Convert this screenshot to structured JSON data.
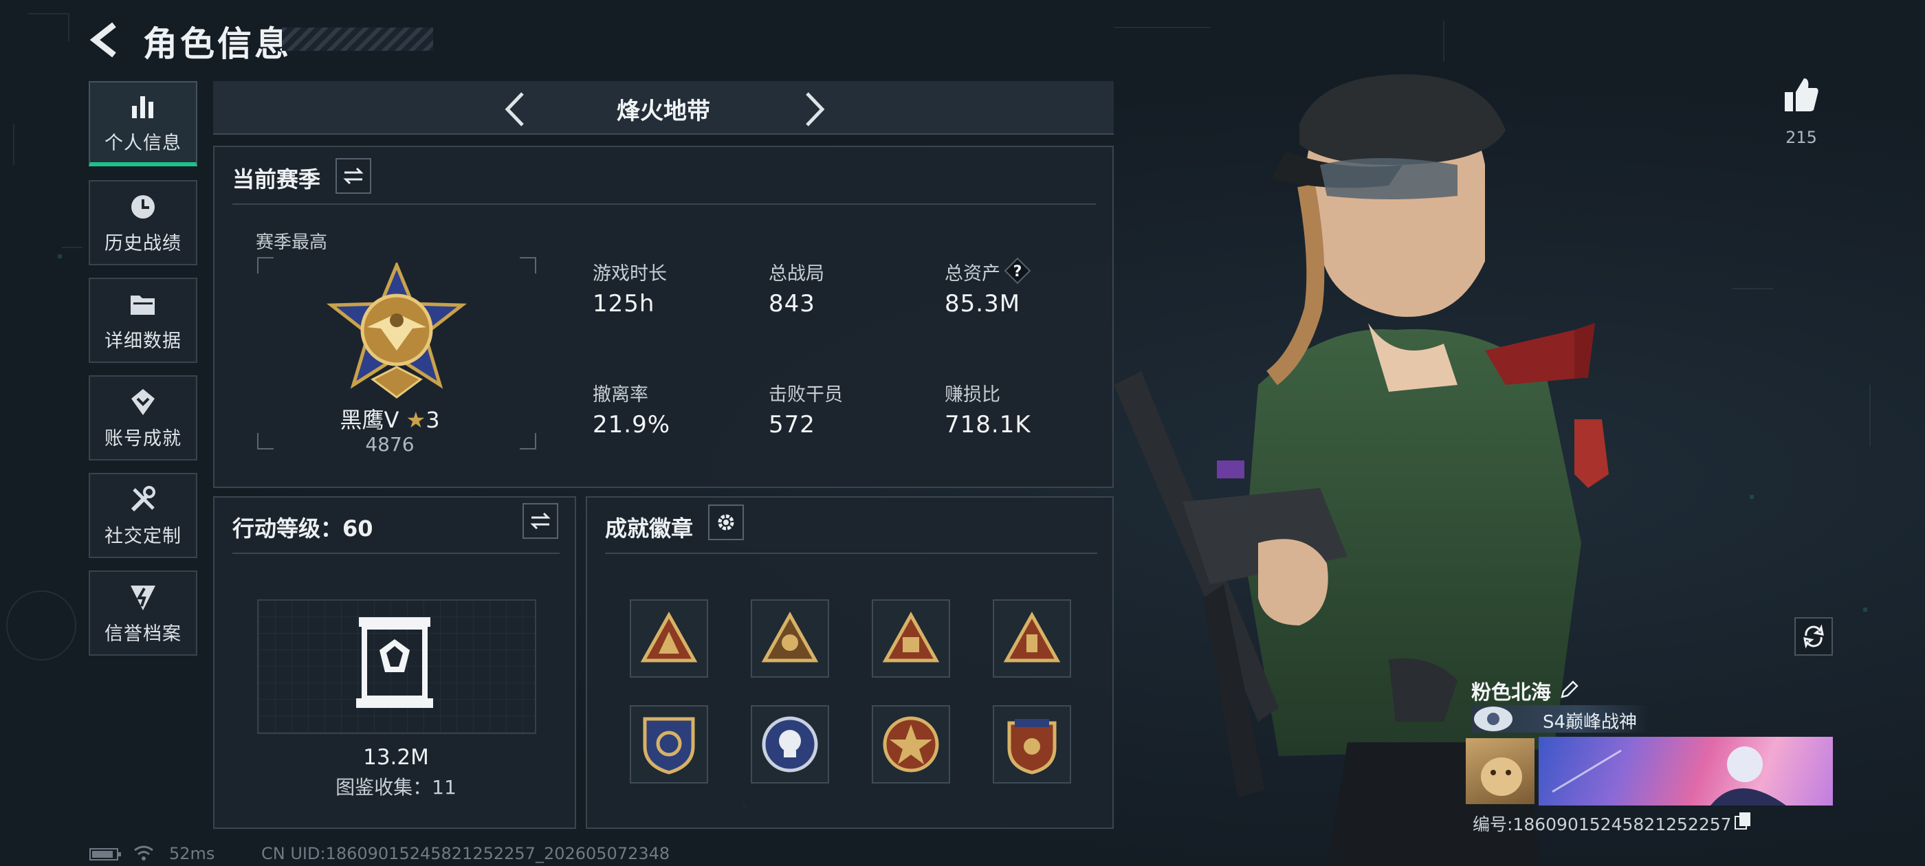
{
  "header": {
    "title": "角色信息"
  },
  "sidebar": {
    "items": [
      {
        "label": "个人信息",
        "icon": "bar-chart-icon",
        "active": true
      },
      {
        "label": "历史战绩",
        "icon": "history-clock-icon",
        "active": false
      },
      {
        "label": "详细数据",
        "icon": "folder-icon",
        "active": false
      },
      {
        "label": "账号成就",
        "icon": "achievement-icon",
        "active": false
      },
      {
        "label": "社交定制",
        "icon": "tools-icon",
        "active": false
      },
      {
        "label": "信誉档案",
        "icon": "shield-bolt-icon",
        "active": false
      }
    ]
  },
  "mode": {
    "label": "烽火地带"
  },
  "season": {
    "title": "当前赛季",
    "best_label": "赛季最高",
    "rank_name": "黑鹰Ⅴ",
    "rank_stars": "3",
    "rank_points": "4876",
    "stats": [
      {
        "label": "游戏时长",
        "value": "125h"
      },
      {
        "label": "总战局",
        "value": "843"
      },
      {
        "label": "总资产",
        "value": "85.3M",
        "has_help": true,
        "help": "?"
      },
      {
        "label": "撤离率",
        "value": "21.9%"
      },
      {
        "label": "击败干员",
        "value": "572"
      },
      {
        "label": "赚损比",
        "value": "718.1K"
      }
    ]
  },
  "action_level": {
    "title": "行动等级：60",
    "value": "13.2M",
    "collection": "图鉴收集：11"
  },
  "badges": {
    "title": "成就徽章",
    "items": [
      "triangle-badge-1",
      "triangle-badge-2",
      "triangle-badge-sb",
      "triangle-badge-4",
      "shield-badge-1",
      "skull-badge",
      "star-badge",
      "crest-badge"
    ]
  },
  "likes": {
    "count": "215"
  },
  "profile": {
    "name": "粉色北海",
    "rank_title": "S4巅峰战神",
    "uid": "编号:1860901524582125225​7"
  },
  "status_bar": {
    "ping": "52ms",
    "cn_uid": "CN UID:1860901524582125225​7_202605072348"
  },
  "colors": {
    "accent": "#20c08a",
    "gold": "#c9a24a",
    "panel": "#1c252e"
  }
}
